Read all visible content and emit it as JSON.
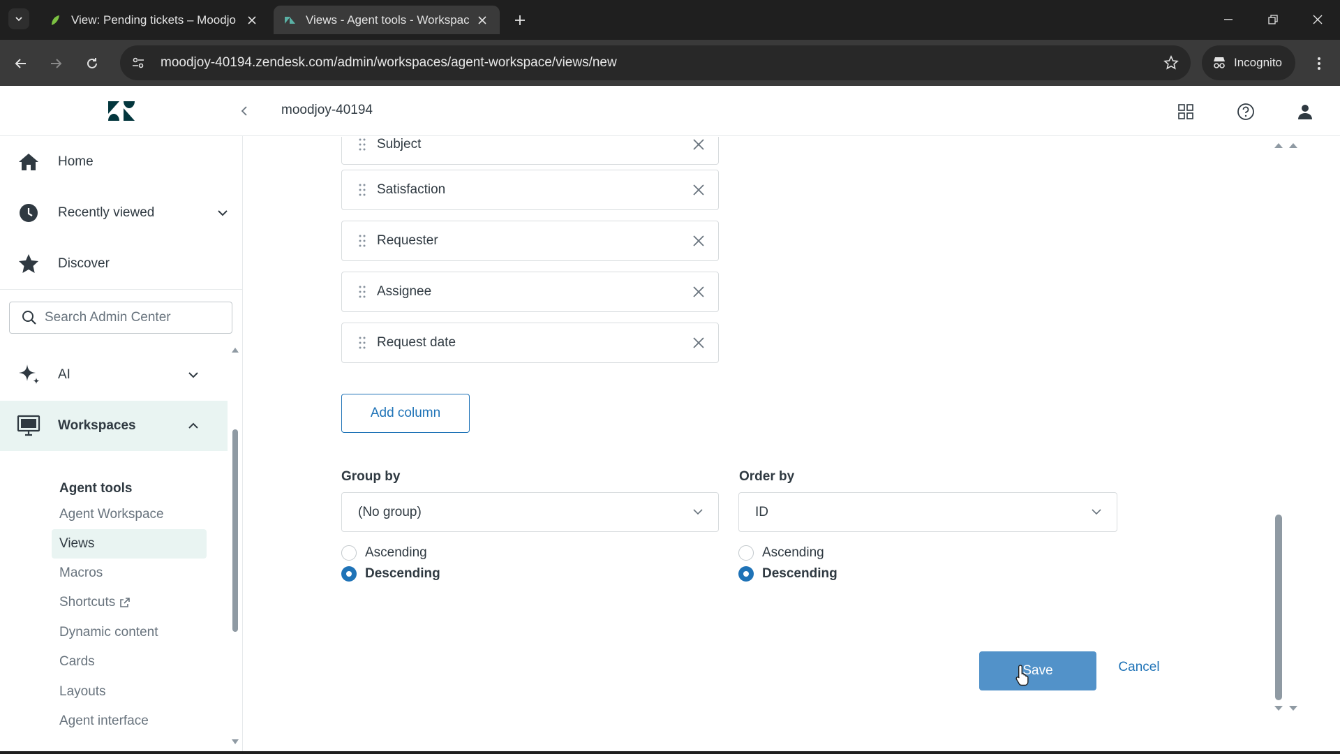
{
  "browser": {
    "tabs": [
      {
        "title": "View: Pending tickets – Moodjo",
        "active": false
      },
      {
        "title": "Views - Agent tools - Workspac",
        "active": true
      }
    ],
    "url": "moodjoy-40194.zendesk.com/admin/workspaces/agent-workspace/views/new",
    "incognito_label": "Incognito"
  },
  "header": {
    "account": "moodjoy-40194"
  },
  "sidebar": {
    "top_items": [
      {
        "label": "Home",
        "icon": "home-icon"
      },
      {
        "label": "Recently viewed",
        "icon": "clock-icon"
      },
      {
        "label": "Discover",
        "icon": "star-icon"
      }
    ],
    "search_placeholder": "Search Admin Center",
    "sections": [
      {
        "label": "AI",
        "icon": "sparkle-icon",
        "expanded": false
      },
      {
        "label": "Workspaces",
        "icon": "monitor-icon",
        "expanded": true
      }
    ],
    "sub_heading": "Agent tools",
    "sub_items": [
      "Agent Workspace",
      "Views",
      "Macros",
      "Shortcuts",
      "Dynamic content",
      "Cards",
      "Layouts",
      "Agent interface"
    ],
    "active_sub_item": "Views"
  },
  "main": {
    "columns": [
      "Subject",
      "Satisfaction",
      "Requester",
      "Assignee",
      "Request date"
    ],
    "add_column_label": "Add column",
    "group_by": {
      "label": "Group by",
      "value": "(No group)",
      "options": [
        "Ascending",
        "Descending"
      ],
      "selected": "Descending"
    },
    "order_by": {
      "label": "Order by",
      "value": "ID",
      "options": [
        "Ascending",
        "Descending"
      ],
      "selected": "Descending"
    },
    "cancel_label": "Cancel",
    "save_label": "Save"
  },
  "colors": {
    "accent": "#1f73b7",
    "save_button": "#5292c9",
    "active_nav_bg": "#e9f4f2",
    "chrome_dark": "#1f1f1f"
  }
}
